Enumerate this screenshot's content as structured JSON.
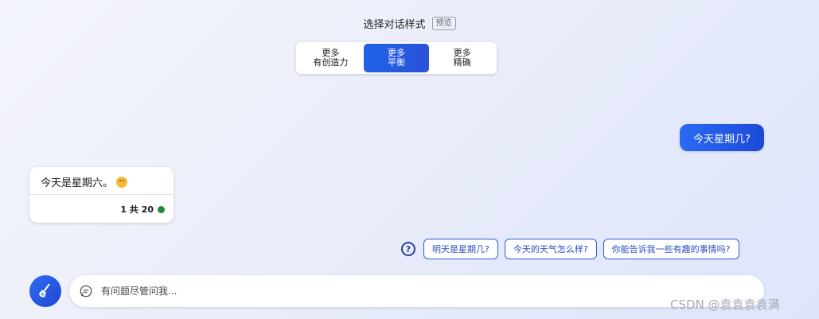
{
  "header": {
    "title": "选择对话样式",
    "badge": "预览"
  },
  "style_options": [
    {
      "line1": "更多",
      "line2": "有创造力",
      "active": false
    },
    {
      "line1": "更多",
      "line2": "平衡",
      "active": true
    },
    {
      "line1": "更多",
      "line2": "精确",
      "active": false
    }
  ],
  "conversation": {
    "user_message": "今天星期几?",
    "bot_message": "今天是星期六。",
    "bot_footer": "1 共 20"
  },
  "suggestions": [
    "明天是星期几?",
    "今天的天气怎么样?",
    "你能告诉我一些有趣的事情吗?"
  ],
  "input": {
    "placeholder": "有问题尽管问我..."
  },
  "watermark": "CSDN @袁袁袁袁满",
  "colors": {
    "accent": "#1f63e9",
    "status": "#218a3a"
  }
}
